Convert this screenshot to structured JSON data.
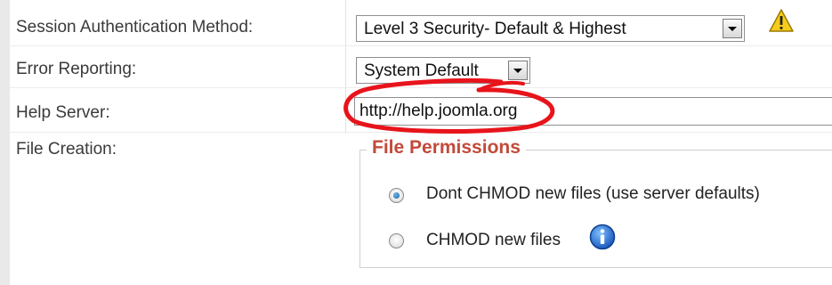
{
  "rows": {
    "session_auth": {
      "label": "Session Authentication Method:",
      "selected": "Level 3 Security- Default & Highest",
      "warning_icon": "warning-triangle-icon"
    },
    "error_reporting": {
      "label": "Error Reporting:",
      "selected": "System Default"
    },
    "help_server": {
      "label": "Help Server:",
      "value": "http://help.joomla.org",
      "annotation": "red-hand-drawn-circle"
    },
    "file_creation": {
      "label": "File Creation:",
      "legend": "File Permissions",
      "options": [
        {
          "label": "Dont CHMOD new files (use server defaults)",
          "checked": true
        },
        {
          "label": "CHMOD new files",
          "checked": false,
          "icon": "info-icon"
        }
      ]
    }
  },
  "colors": {
    "legend": "#c24a3a",
    "annotation": "#e8141b",
    "warning": "#f2c200",
    "info": "#1d6fd0"
  }
}
